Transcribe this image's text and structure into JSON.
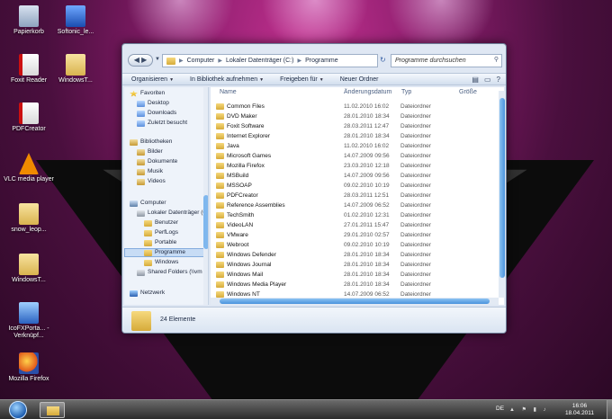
{
  "desktop": {
    "icons": [
      {
        "label": "Papierkorb"
      },
      {
        "label": "Softonic_le..."
      },
      {
        "label": "Foxit Reader"
      },
      {
        "label": "WindowsT..."
      },
      {
        "label": "PDFCreator"
      },
      {
        "label": "VLC media player"
      },
      {
        "label": "snow_leop..."
      },
      {
        "label": "WindowsT..."
      },
      {
        "label": "IcoFXPorta... - Verknüpf..."
      },
      {
        "label": "Mozilla Firefox"
      }
    ]
  },
  "explorer": {
    "breadcrumb": [
      "Computer",
      "Lokaler Datenträger (C:)",
      "Programme"
    ],
    "search_placeholder": "Programme durchsuchen",
    "toolbar": {
      "organize": "Organisieren",
      "library": "In Bibliothek aufnehmen",
      "share": "Freigeben für",
      "new_folder": "Neuer Ordner"
    },
    "nav": {
      "favorites": "Favoriten",
      "desktop": "Desktop",
      "downloads": "Downloads",
      "recent": "Zuletzt besucht",
      "libraries": "Bibliotheken",
      "pictures": "Bilder",
      "documents": "Dokumente",
      "music": "Musik",
      "videos": "Videos",
      "computer": "Computer",
      "drive": "Lokaler Datenträger (C",
      "users": "Benutzer",
      "perflogs": "PerfLogs",
      "portable": "Portable",
      "programs": "Programme",
      "windows": "Windows",
      "shared": "Shared Folders (\\\\vm",
      "network": "Netzwerk"
    },
    "columns": {
      "name": "Name",
      "date": "Änderungsdatum",
      "type": "Typ",
      "size": "Größe"
    },
    "files": [
      {
        "name": "Common Files",
        "date": "11.02.2010 16:02",
        "type": "Dateiordner"
      },
      {
        "name": "DVD Maker",
        "date": "28.01.2010 18:34",
        "type": "Dateiordner"
      },
      {
        "name": "Foxit Software",
        "date": "28.03.2011 12:47",
        "type": "Dateiordner"
      },
      {
        "name": "Internet Explorer",
        "date": "28.01.2010 18:34",
        "type": "Dateiordner"
      },
      {
        "name": "Java",
        "date": "11.02.2010 16:02",
        "type": "Dateiordner"
      },
      {
        "name": "Microsoft Games",
        "date": "14.07.2009 09:56",
        "type": "Dateiordner"
      },
      {
        "name": "Mozilla Firefox",
        "date": "23.03.2010 12:18",
        "type": "Dateiordner"
      },
      {
        "name": "MSBuild",
        "date": "14.07.2009 09:56",
        "type": "Dateiordner"
      },
      {
        "name": "MSSOAP",
        "date": "09.02.2010 10:19",
        "type": "Dateiordner"
      },
      {
        "name": "PDFCreator",
        "date": "28.03.2011 12:51",
        "type": "Dateiordner"
      },
      {
        "name": "Reference Assemblies",
        "date": "14.07.2009 06:52",
        "type": "Dateiordner"
      },
      {
        "name": "TechSmith",
        "date": "01.02.2010 12:31",
        "type": "Dateiordner"
      },
      {
        "name": "VideoLAN",
        "date": "27.01.2011 15:47",
        "type": "Dateiordner"
      },
      {
        "name": "VMware",
        "date": "29.01.2010 02:57",
        "type": "Dateiordner"
      },
      {
        "name": "Webroot",
        "date": "09.02.2010 10:19",
        "type": "Dateiordner"
      },
      {
        "name": "Windows Defender",
        "date": "28.01.2010 18:34",
        "type": "Dateiordner"
      },
      {
        "name": "Windows Journal",
        "date": "28.01.2010 18:34",
        "type": "Dateiordner"
      },
      {
        "name": "Windows Mail",
        "date": "28.01.2010 18:34",
        "type": "Dateiordner"
      },
      {
        "name": "Windows Media Player",
        "date": "28.01.2010 18:34",
        "type": "Dateiordner"
      },
      {
        "name": "Windows NT",
        "date": "14.07.2009 06:52",
        "type": "Dateiordner"
      }
    ],
    "status": "24 Elemente"
  },
  "taskbar": {
    "lang": "DE",
    "time": "16:06",
    "date": "18.04.2011"
  }
}
